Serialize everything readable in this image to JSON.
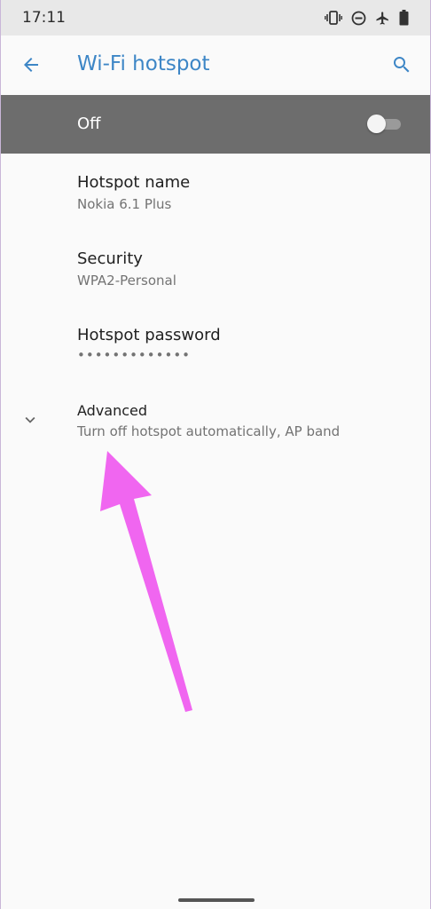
{
  "status_bar": {
    "time": "17:11",
    "icons": [
      "vibrate-icon",
      "do-not-disturb-icon",
      "airplane-icon",
      "battery-icon"
    ]
  },
  "app_bar": {
    "title": "Wi-Fi hotspot",
    "back_icon": "arrow-back-icon",
    "search_icon": "search-icon",
    "accent_color": "#3d86c6"
  },
  "master_switch": {
    "label": "Off",
    "state": "off",
    "background_color": "#6d6d6d"
  },
  "preferences": [
    {
      "title": "Hotspot name",
      "summary": "Nokia 6.1 Plus"
    },
    {
      "title": "Security",
      "summary": "WPA2-Personal"
    },
    {
      "title": "Hotspot password",
      "summary": "•••••••••••••"
    },
    {
      "title": "Advanced",
      "summary": "Turn off hotspot automatically, AP band"
    }
  ],
  "annotation": {
    "color": "#f066f0"
  }
}
